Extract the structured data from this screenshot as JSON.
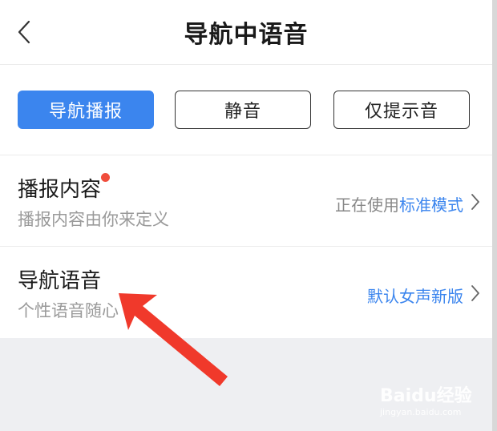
{
  "header": {
    "title": "导航中语音"
  },
  "modes": [
    {
      "label": "导航播报",
      "active": true
    },
    {
      "label": "静音",
      "active": false
    },
    {
      "label": "仅提示音",
      "active": false
    }
  ],
  "rows": [
    {
      "title": "播报内容",
      "subtitle": "播报内容由你来定义",
      "right_prefix": "正在使用",
      "right_value": "标准模式",
      "has_red_dot": true
    },
    {
      "title": "导航语音",
      "subtitle": "个性语音随心",
      "right_prefix": "",
      "right_value": "默认女声新版",
      "has_red_dot": false
    }
  ],
  "watermark": {
    "text": "Baidu经验",
    "subtext": "jingyan.baidu.com"
  },
  "colors": {
    "accent": "#3b85ee",
    "red_dot": "#f04d3c",
    "arrow": "#f0392b"
  },
  "icons": [
    "back-arrow-icon",
    "chevron-right-icon",
    "red-dot-badge",
    "annotation-arrow"
  ]
}
